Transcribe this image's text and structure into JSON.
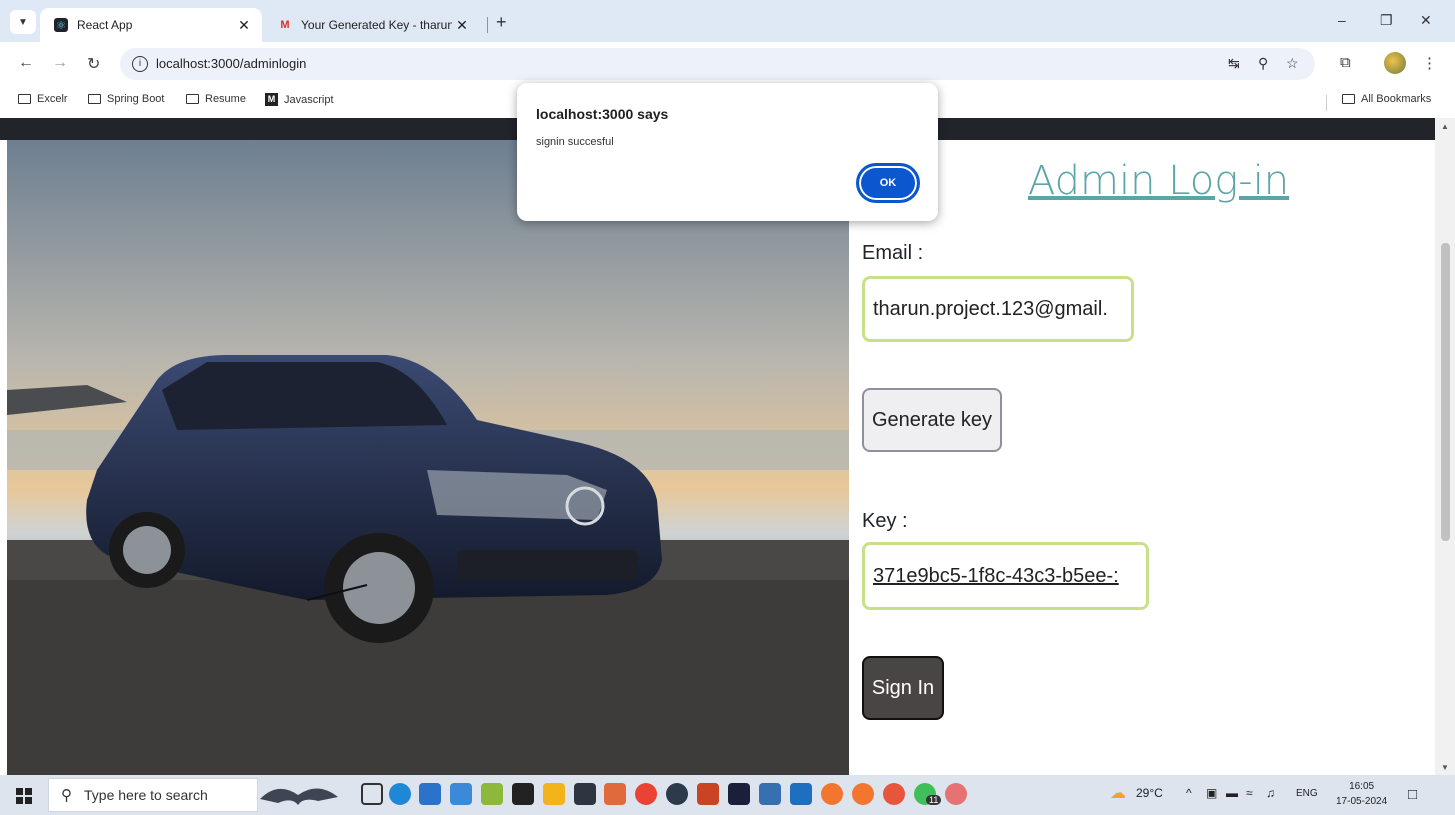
{
  "browser": {
    "tabs": [
      {
        "label": "React App",
        "favicon": "react-icon",
        "active": true
      },
      {
        "label": "Your Generated Key - tharun.pr",
        "favicon": "gmail-icon",
        "active": false
      }
    ],
    "url": "localhost:3000/adminlogin",
    "bookmarks": [
      "Excelr",
      "Spring Boot",
      "Resume",
      "Javascript"
    ],
    "all_bookmarks": "All Bookmarks"
  },
  "dialog": {
    "title": "localhost:3000 says",
    "message": "signin succesful",
    "ok_label": "OK"
  },
  "page": {
    "title": "Admin Log-in",
    "email_label": "Email :",
    "email_value": "tharun.project.123@gmail.",
    "generate_label": "Generate key",
    "key_label": "Key :",
    "key_value": "371e9bc5-1f8c-43c3-b5ee-:",
    "signin_label": "Sign In"
  },
  "taskbar": {
    "search_placeholder": "Type here to search",
    "temperature": "29°C",
    "language": "ENG",
    "time": "16:05",
    "date": "17-05-2024",
    "whatsapp_badge": "11"
  },
  "colors": {
    "title_teal": "#5aa5a8",
    "input_border": "#c9e08a",
    "signin_bg": "#4a4545",
    "dialog_ok": "#0b57d0"
  }
}
